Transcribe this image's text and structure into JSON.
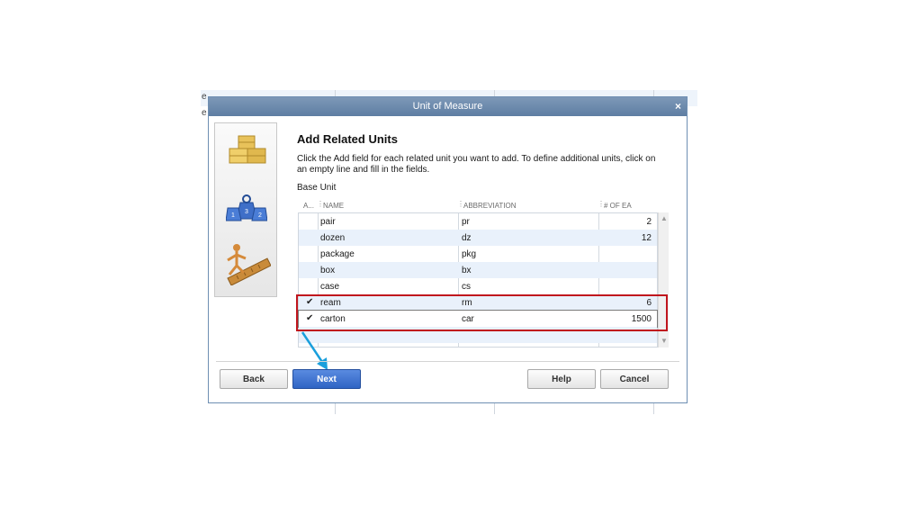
{
  "background": {
    "fragments": [
      "e",
      "e"
    ]
  },
  "dialog": {
    "title": "Unit of Measure",
    "close_label": "×",
    "heading": "Add Related Units",
    "description": "Click the Add field for each related unit you want to add. To define additional units, click on an empty line and fill in the fields.",
    "base_unit_label": "Base Unit",
    "icons": [
      "stacked-boxes-icon",
      "weights-icon",
      "ruler-measure-icon"
    ]
  },
  "grid": {
    "columns": {
      "add": "A...",
      "name": "NAME",
      "abbreviation": "ABBREVIATION",
      "count": "# OF EA"
    },
    "rows": [
      {
        "checked": false,
        "name": "pair",
        "abbr": "pr",
        "count": "2"
      },
      {
        "checked": false,
        "name": "dozen",
        "abbr": "dz",
        "count": "12"
      },
      {
        "checked": false,
        "name": "package",
        "abbr": "pkg",
        "count": ""
      },
      {
        "checked": false,
        "name": "box",
        "abbr": "bx",
        "count": ""
      },
      {
        "checked": false,
        "name": "case",
        "abbr": "cs",
        "count": ""
      },
      {
        "checked": true,
        "name": "ream",
        "abbr": "rm",
        "count": "6"
      },
      {
        "checked": true,
        "name": "carton",
        "abbr": "car",
        "count": "1500"
      },
      {
        "checked": false,
        "name": "",
        "abbr": "",
        "count": ""
      }
    ],
    "check_glyph": "✔",
    "scroll_up": "▲",
    "scroll_down": "▼"
  },
  "buttons": {
    "back": "Back",
    "next": "Next",
    "help": "Help",
    "cancel": "Cancel"
  },
  "colors": {
    "highlight": "#c0151d",
    "arrow": "#1a9fdc",
    "next_button": "#2f64c4"
  }
}
